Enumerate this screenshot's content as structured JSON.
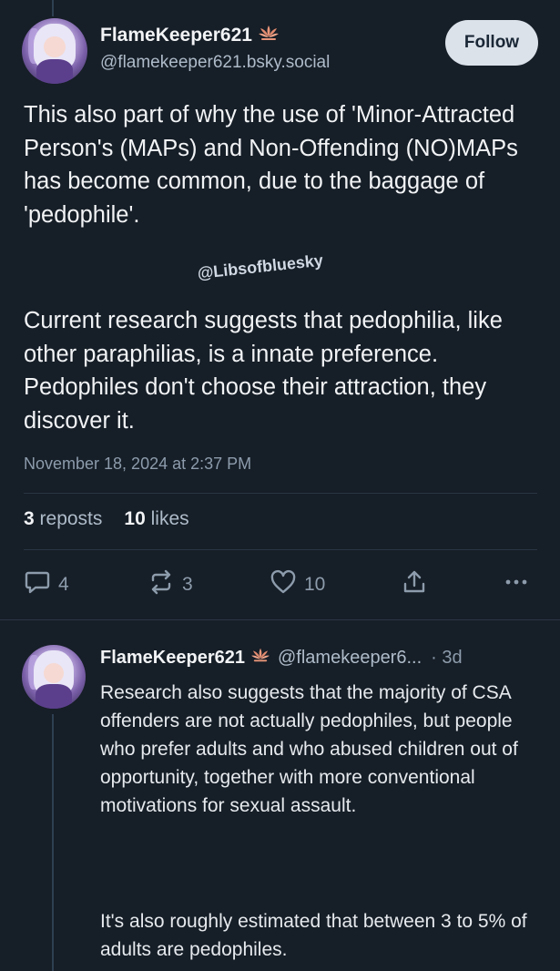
{
  "post": {
    "display_name": "FlameKeeper621",
    "handle": "@flamekeeper621.bsky.social",
    "follow_label": "Follow",
    "paragraph1": "This also part of why the use of 'Minor-Attracted Person's (MAPs) and Non-Offending (NO)MAPs has become common, due to the baggage of 'pedophile'.",
    "watermark": "@Libsofbluesky",
    "paragraph2": "Current research suggests that pedophilia, like other paraphilias, is a innate preference. Pedophiles don't choose their attraction, they discover it.",
    "timestamp": "November 18, 2024 at 2:37 PM",
    "reposts_count": "3",
    "reposts_label": "reposts",
    "likes_count": "10",
    "likes_label": "likes",
    "actions": {
      "reply_count": "4",
      "repost_count": "3",
      "like_count": "10"
    }
  },
  "reply": {
    "display_name": "FlameKeeper621",
    "handle": "@flamekeeper6...",
    "time": "· 3d",
    "paragraph1": "Research also suggests that the majority of CSA offenders are not actually pedophiles, but people who prefer adults and who abused children out of opportunity, together with more conventional motivations for sexual assault.",
    "paragraph2": "It's also roughly estimated that between 3 to 5% of adults are pedophiles."
  },
  "icons": {
    "badge": "lotus-icon",
    "reply": "speech-bubble-icon",
    "repost": "repost-arrows-icon",
    "like": "heart-icon",
    "share": "share-icon",
    "more": "more-dots-icon"
  },
  "colors": {
    "background": "#161e27",
    "badge": "#e9967a",
    "follow_bg": "#dce2ea"
  }
}
